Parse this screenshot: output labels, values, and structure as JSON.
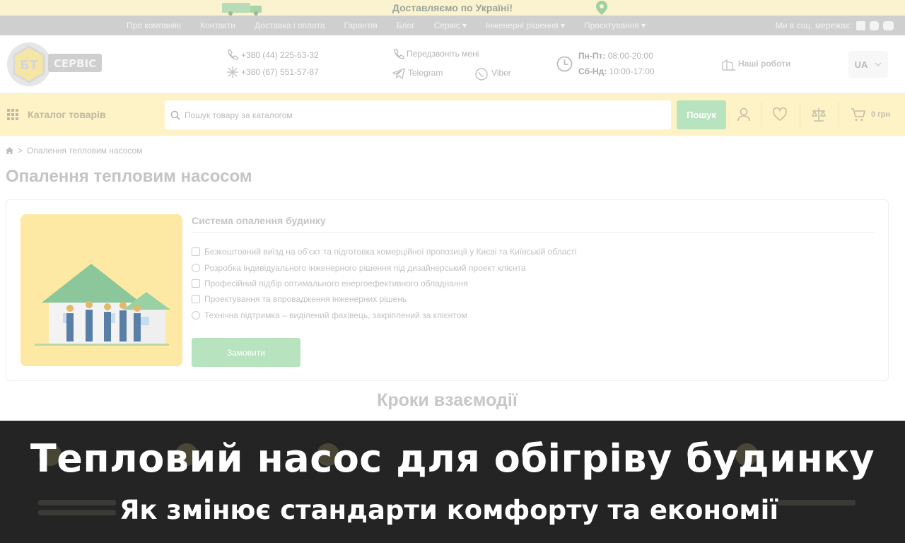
{
  "promo": {
    "text": "Доставляємо по Україні!"
  },
  "topnav": {
    "links": [
      "Про компанію",
      "Контакти",
      "Доставка і оплата",
      "Гарантія",
      "Блог",
      "Сервіс ▾",
      "Інженерні рішення ▾",
      "Проєктування ▾"
    ],
    "social_label": "Ми в соц. мережах:",
    "social_icons": [
      "facebook-icon",
      "instagram-icon",
      "youtube-icon"
    ]
  },
  "header": {
    "logo_text_left": "БТ",
    "logo_text_right": "СЕРВІС",
    "phone1": "+380 (44) 225-63-32",
    "phone2": "+380 (67) 551-57-87",
    "callback": "Передзвоніть мені",
    "telegram": "Telegram",
    "viber": "Viber",
    "hours_weekday_label": "Пн-Пт:",
    "hours_weekday": "08:00-20:00",
    "hours_weekend_label": "Сб-Нд:",
    "hours_weekend": "10:00-17:00",
    "our_works": "Наші роботи",
    "lang": "UA"
  },
  "catbar": {
    "catalog_label": "Каталог товарів",
    "search_placeholder": "Пошук товару за каталогом",
    "search_button": "Пошук",
    "cart_total": "0 грн"
  },
  "breadcrumb": {
    "current": "Опалення тепловим насосом"
  },
  "page": {
    "title": "Опалення тепловим насосом",
    "card_title": "Система опалення будинку",
    "features": [
      "Безкоштовний виїзд на об'єкт та підготовка комерційної пропозиції у Києві та Київській області",
      "Розробка індивідуального інженерного рішення під дизайнерський проект клієнта",
      "Професійний підбір оптимального енергоефективного обладнання",
      "Проектування та впровадження інженерних рішень",
      "Технічна підтримка – виділений фахівець, закріплений за клієнтом"
    ],
    "order_button": "Замовити",
    "steps_title": "Кроки взаємодії"
  },
  "overlay": {
    "title": "Тепловий насос для обігріву будинку",
    "subtitle": "Як змінює стандарти комфорту та економії"
  },
  "colors": {
    "accent_green": "#b8e3bf",
    "accent_yellow": "#fdf3c6",
    "overlay_bg": "#242424"
  }
}
